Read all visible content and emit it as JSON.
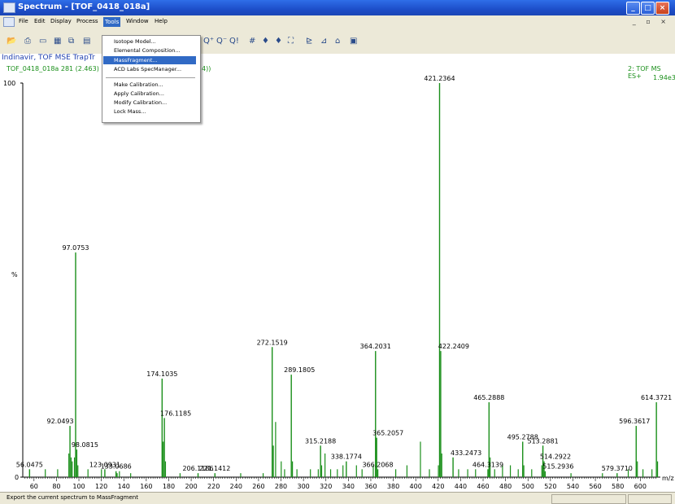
{
  "window": {
    "title": "Spectrum - [TOF_0418_018a]"
  },
  "menubar": [
    "File",
    "Edit",
    "Display",
    "Process",
    "Tools",
    "Window",
    "Help"
  ],
  "tools_menu": {
    "group1": [
      "Isotope Model...",
      "Elemental Composition...",
      "MassFragment...",
      "ACD Labs SpecManager..."
    ],
    "group2": [
      "Make Calibration...",
      "Apply Calibration...",
      "Modify Calibration...",
      "Lock Mass..."
    ],
    "highlighted": "MassFragment..."
  },
  "spectrum_header": {
    "sample": "Indinavir, TOF MSE TrapTr",
    "scan": "TOF_0418_018a 281 (2.463)",
    "scan_suffix": "4))",
    "function": "2: TOF MS ES+",
    "intensity": "1.94e3"
  },
  "statusbar": {
    "text": "Export the current spectrum to MassFragment"
  },
  "colors": {
    "title_blue": "#1d4ec9",
    "menu_highlight": "#316ac5",
    "spectrum_green": "#1a8f1a",
    "header_blue": "#1f3fae"
  },
  "chart_data": {
    "type": "bar",
    "y_axis_label": "%",
    "x_unit": "m/z",
    "ylim": [
      0,
      100
    ],
    "xlim": [
      50,
      615
    ],
    "y_ticks": [
      "100",
      "0"
    ],
    "x_ticks": [
      "60",
      "80",
      "100",
      "120",
      "140",
      "160",
      "180",
      "200",
      "220",
      "240",
      "260",
      "280",
      "300",
      "320",
      "340",
      "360",
      "380",
      "400",
      "420",
      "440",
      "460",
      "480",
      "500",
      "520",
      "540",
      "560",
      "580",
      "600"
    ],
    "labeled_peaks": [
      {
        "mz": 56.0475,
        "label": "56.0475",
        "rel": 2
      },
      {
        "mz": 92.0493,
        "label": "92.0493",
        "rel": 13
      },
      {
        "mz": 97.0753,
        "label": "97.0753",
        "rel": 57
      },
      {
        "mz": 98.0815,
        "label": "98.0815",
        "rel": 7
      },
      {
        "mz": 123.0931,
        "label": "123.0931",
        "rel": 2
      },
      {
        "mz": 133.0686,
        "label": "133.0686",
        "rel": 1.5
      },
      {
        "mz": 174.1035,
        "label": "174.1035",
        "rel": 25
      },
      {
        "mz": 176.1185,
        "label": "176.1185",
        "rel": 15
      },
      {
        "mz": 206.1186,
        "label": "206.1186",
        "rel": 1
      },
      {
        "mz": 221.1412,
        "label": "221.1412",
        "rel": 1
      },
      {
        "mz": 272.1519,
        "label": "272.1519",
        "rel": 33
      },
      {
        "mz": 289.1805,
        "label": "289.1805",
        "rel": 26
      },
      {
        "mz": 315.2188,
        "label": "315.2188",
        "rel": 8
      },
      {
        "mz": 338.1774,
        "label": "338.1774",
        "rel": 4
      },
      {
        "mz": 364.2031,
        "label": "364.2031",
        "rel": 32
      },
      {
        "mz": 365.2057,
        "label": "365.2057",
        "rel": 10
      },
      {
        "mz": 366.2068,
        "label": "366.2068",
        "rel": 2
      },
      {
        "mz": 421.2364,
        "label": "421.2364",
        "rel": 100
      },
      {
        "mz": 422.2409,
        "label": "422.2409",
        "rel": 32
      },
      {
        "mz": 433.2473,
        "label": "433.2473",
        "rel": 5
      },
      {
        "mz": 464.3139,
        "label": "464.3139",
        "rel": 2
      },
      {
        "mz": 465.2888,
        "label": "465.2888",
        "rel": 19
      },
      {
        "mz": 495.2788,
        "label": "495.2788",
        "rel": 9
      },
      {
        "mz": 513.2881,
        "label": "513.2881",
        "rel": 8
      },
      {
        "mz": 514.2922,
        "label": "514.2922",
        "rel": 4
      },
      {
        "mz": 515.2936,
        "label": "515.2936",
        "rel": 1.5
      },
      {
        "mz": 579.371,
        "label": "579.3710",
        "rel": 1
      },
      {
        "mz": 596.3617,
        "label": "596.3617",
        "rel": 13
      },
      {
        "mz": 614.3721,
        "label": "614.3721",
        "rel": 19
      }
    ],
    "minor_peaks": [
      {
        "mz": 70.07,
        "rel": 2
      },
      {
        "mz": 81.07,
        "rel": 2
      },
      {
        "mz": 91.05,
        "rel": 6
      },
      {
        "mz": 93.06,
        "rel": 5
      },
      {
        "mz": 94.06,
        "rel": 4
      },
      {
        "mz": 96.05,
        "rel": 5
      },
      {
        "mz": 99.08,
        "rel": 3
      },
      {
        "mz": 108.08,
        "rel": 2
      },
      {
        "mz": 120.08,
        "rel": 2
      },
      {
        "mz": 134.07,
        "rel": 1
      },
      {
        "mz": 136.08,
        "rel": 1.5
      },
      {
        "mz": 146.1,
        "rel": 1
      },
      {
        "mz": 175.1,
        "rel": 9
      },
      {
        "mz": 177.1,
        "rel": 4
      },
      {
        "mz": 190.1,
        "rel": 1
      },
      {
        "mz": 244.1,
        "rel": 1
      },
      {
        "mz": 264.1,
        "rel": 1
      },
      {
        "mz": 273.2,
        "rel": 8
      },
      {
        "mz": 275.2,
        "rel": 14
      },
      {
        "mz": 280.2,
        "rel": 4
      },
      {
        "mz": 283.2,
        "rel": 2
      },
      {
        "mz": 290.2,
        "rel": 4
      },
      {
        "mz": 294.2,
        "rel": 2
      },
      {
        "mz": 306.2,
        "rel": 2
      },
      {
        "mz": 313.2,
        "rel": 2
      },
      {
        "mz": 316.2,
        "rel": 3
      },
      {
        "mz": 319.2,
        "rel": 6
      },
      {
        "mz": 324.2,
        "rel": 2
      },
      {
        "mz": 330.2,
        "rel": 2
      },
      {
        "mz": 335.2,
        "rel": 3
      },
      {
        "mz": 347.2,
        "rel": 3
      },
      {
        "mz": 352.2,
        "rel": 2
      },
      {
        "mz": 362.2,
        "rel": 3
      },
      {
        "mz": 382.2,
        "rel": 2
      },
      {
        "mz": 392.2,
        "rel": 3
      },
      {
        "mz": 404.2,
        "rel": 9
      },
      {
        "mz": 412.2,
        "rel": 2
      },
      {
        "mz": 420.2,
        "rel": 3
      },
      {
        "mz": 423.2,
        "rel": 6
      },
      {
        "mz": 438.2,
        "rel": 2
      },
      {
        "mz": 446.3,
        "rel": 2
      },
      {
        "mz": 453.3,
        "rel": 2
      },
      {
        "mz": 466.3,
        "rel": 5
      },
      {
        "mz": 470.3,
        "rel": 2
      },
      {
        "mz": 477.3,
        "rel": 3
      },
      {
        "mz": 484.3,
        "rel": 3
      },
      {
        "mz": 491.3,
        "rel": 2
      },
      {
        "mz": 496.3,
        "rel": 3
      },
      {
        "mz": 503.3,
        "rel": 2
      },
      {
        "mz": 512.3,
        "rel": 3
      },
      {
        "mz": 538.3,
        "rel": 1
      },
      {
        "mz": 566.3,
        "rel": 1
      },
      {
        "mz": 589.3,
        "rel": 2
      },
      {
        "mz": 597.4,
        "rel": 4
      },
      {
        "mz": 602.4,
        "rel": 2
      },
      {
        "mz": 610.4,
        "rel": 2
      },
      {
        "mz": 615.4,
        "rel": 4
      }
    ]
  }
}
